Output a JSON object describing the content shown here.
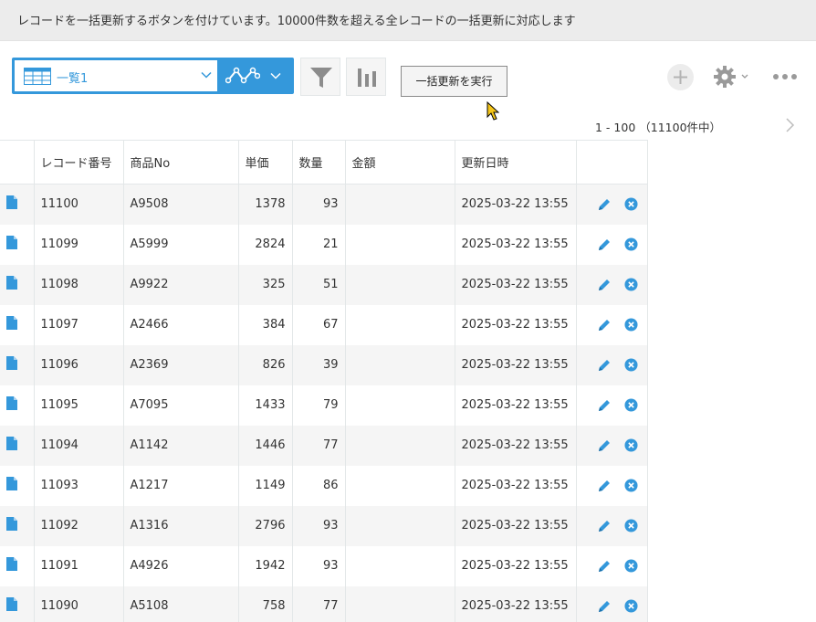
{
  "banner": {
    "text": "レコードを一括更新するボタンを付けています。10000件数を超える全レコードの一括更新に対応します"
  },
  "toolbar": {
    "view_label": "一覧1",
    "bulk_update_label": "一括更新を実行"
  },
  "pager": {
    "range": "1 - 100",
    "total": "（11100件中）"
  },
  "table": {
    "columns": [
      "レコード番号",
      "商品No",
      "単価",
      "数量",
      "金額",
      "更新日時"
    ],
    "rows": [
      {
        "id": "11100",
        "product": "A9508",
        "price": "1378",
        "qty": "93",
        "amount": "",
        "updated": "2025-03-22 13:55"
      },
      {
        "id": "11099",
        "product": "A5999",
        "price": "2824",
        "qty": "21",
        "amount": "",
        "updated": "2025-03-22 13:55"
      },
      {
        "id": "11098",
        "product": "A9922",
        "price": "325",
        "qty": "51",
        "amount": "",
        "updated": "2025-03-22 13:55"
      },
      {
        "id": "11097",
        "product": "A2466",
        "price": "384",
        "qty": "67",
        "amount": "",
        "updated": "2025-03-22 13:55"
      },
      {
        "id": "11096",
        "product": "A2369",
        "price": "826",
        "qty": "39",
        "amount": "",
        "updated": "2025-03-22 13:55"
      },
      {
        "id": "11095",
        "product": "A7095",
        "price": "1433",
        "qty": "79",
        "amount": "",
        "updated": "2025-03-22 13:55"
      },
      {
        "id": "11094",
        "product": "A1142",
        "price": "1446",
        "qty": "77",
        "amount": "",
        "updated": "2025-03-22 13:55"
      },
      {
        "id": "11093",
        "product": "A1217",
        "price": "1149",
        "qty": "86",
        "amount": "",
        "updated": "2025-03-22 13:55"
      },
      {
        "id": "11092",
        "product": "A1316",
        "price": "2796",
        "qty": "93",
        "amount": "",
        "updated": "2025-03-22 13:55"
      },
      {
        "id": "11091",
        "product": "A4926",
        "price": "1942",
        "qty": "93",
        "amount": "",
        "updated": "2025-03-22 13:55"
      },
      {
        "id": "11090",
        "product": "A5108",
        "price": "758",
        "qty": "77",
        "amount": "",
        "updated": "2025-03-22 13:55"
      }
    ]
  },
  "icons": {
    "view": "table-view-icon",
    "graph": "graph-icon",
    "filter": "filter-icon",
    "chart": "bar-chart-icon",
    "add": "plus-icon",
    "settings": "gear-icon",
    "more": "more-icon",
    "record": "document-icon",
    "edit": "pencil-icon",
    "delete": "delete-circle-icon"
  },
  "colors": {
    "accent": "#3498db",
    "banner_bg": "#ececec",
    "row_alt": "#f5f5f5"
  }
}
